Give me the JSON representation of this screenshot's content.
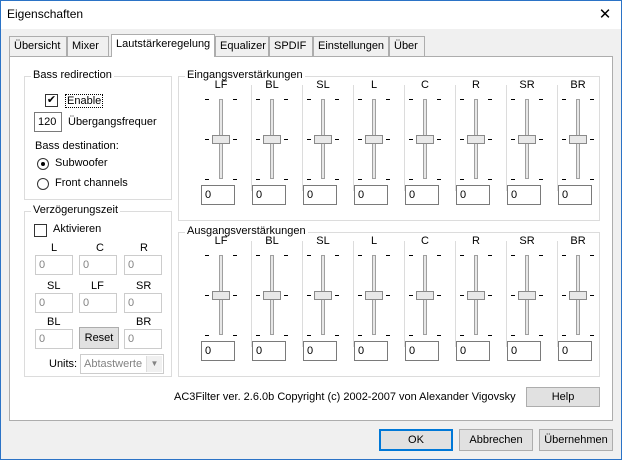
{
  "window": {
    "title": "Eigenschaften"
  },
  "tabs": [
    {
      "label": "Übersicht",
      "active": false
    },
    {
      "label": "Mixer",
      "active": false
    },
    {
      "label": "Lautstärkeregelung",
      "active": true
    },
    {
      "label": "Equalizer",
      "active": false
    },
    {
      "label": "SPDIF",
      "active": false
    },
    {
      "label": "Einstellungen",
      "active": false
    },
    {
      "label": "Über",
      "active": false
    }
  ],
  "bass": {
    "title": "Bass redirection",
    "enable_label": "Enable",
    "enable_checked": true,
    "freq_value": "120",
    "freq_label": "Übergangsfrequer",
    "dest_label": "Bass destination:",
    "opt_subwoofer": "Subwoofer",
    "opt_front": "Front channels",
    "selected": "Subwoofer"
  },
  "delay": {
    "title": "Verzögerungszeit",
    "activate_label": "Aktivieren",
    "activate_checked": false,
    "labels": {
      "L": "L",
      "C": "C",
      "R": "R",
      "SL": "SL",
      "LF": "LF",
      "SR": "SR",
      "BL": "BL",
      "BR": "BR"
    },
    "values": {
      "L": "0",
      "C": "0",
      "R": "0",
      "SL": "0",
      "LF": "0",
      "SR": "0",
      "BL": "0",
      "BR": "0"
    },
    "reset_label": "Reset",
    "units_label": "Units:",
    "units_value": "Abtastwerte"
  },
  "input_gain": {
    "title": "Eingangsverstärkungen",
    "channels": [
      {
        "name": "LF",
        "value": "0",
        "level": 0.5
      },
      {
        "name": "BL",
        "value": "0",
        "level": 0.5
      },
      {
        "name": "SL",
        "value": "0",
        "level": 0.5
      },
      {
        "name": "L",
        "value": "0",
        "level": 0.5
      },
      {
        "name": "C",
        "value": "0",
        "level": 0.5
      },
      {
        "name": "R",
        "value": "0",
        "level": 0.5
      },
      {
        "name": "SR",
        "value": "0",
        "level": 0.5
      },
      {
        "name": "BR",
        "value": "0",
        "level": 0.5
      }
    ]
  },
  "output_gain": {
    "title": "Ausgangsverstärkungen",
    "channels": [
      {
        "name": "LF",
        "value": "0",
        "level": 0.5
      },
      {
        "name": "BL",
        "value": "0",
        "level": 0.5
      },
      {
        "name": "SL",
        "value": "0",
        "level": 0.5
      },
      {
        "name": "L",
        "value": "0",
        "level": 0.5
      },
      {
        "name": "C",
        "value": "0",
        "level": 0.5
      },
      {
        "name": "R",
        "value": "0",
        "level": 0.5
      },
      {
        "name": "SR",
        "value": "0",
        "level": 0.5
      },
      {
        "name": "BR",
        "value": "0",
        "level": 0.5
      }
    ]
  },
  "footer": {
    "copyright": "AC3Filter ver. 2.6.0b Copyright (c) 2002-2007 von Alexander Vigovsky",
    "help_label": "Help"
  },
  "buttons": {
    "ok": "OK",
    "cancel": "Abbrechen",
    "apply": "Übernehmen"
  },
  "icons": {
    "close": "close-icon",
    "check": "checkmark-icon",
    "dropdown": "chevron-down-icon"
  }
}
